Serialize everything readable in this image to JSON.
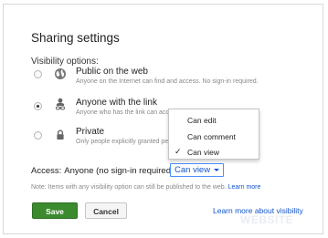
{
  "dialog": {
    "title": "Sharing settings",
    "visibility_label": "Visibility options:"
  },
  "options": [
    {
      "name": "Public on the web",
      "description": "Anyone on the Internet can find and access. No sign-in required.",
      "icon": "globe-icon",
      "selected": false
    },
    {
      "name": "Anyone with the link",
      "description": "Anyone who has the link can acce",
      "icon": "person-link-icon",
      "selected": true
    },
    {
      "name": "Private",
      "description": "Only people explicitly granted per",
      "icon": "lock-icon",
      "selected": false
    }
  ],
  "access": {
    "label": "Access:",
    "value": "Anyone (no sign-in required)",
    "permission": "Can view"
  },
  "dropdown": {
    "items": [
      "Can edit",
      "Can comment",
      "Can view"
    ],
    "checked": "Can view"
  },
  "note": {
    "text": "Note: Items with any visibility option can still be published to the web.",
    "link": "Learn more"
  },
  "buttons": {
    "save": "Save",
    "cancel": "Cancel"
  },
  "learn_more_visibility": "Learn more about visibility",
  "watermark": "WEBSITE",
  "colors": {
    "save_green": "#3c8a2e",
    "link_blue": "#1155cc",
    "focus_blue": "#4d90fe"
  }
}
